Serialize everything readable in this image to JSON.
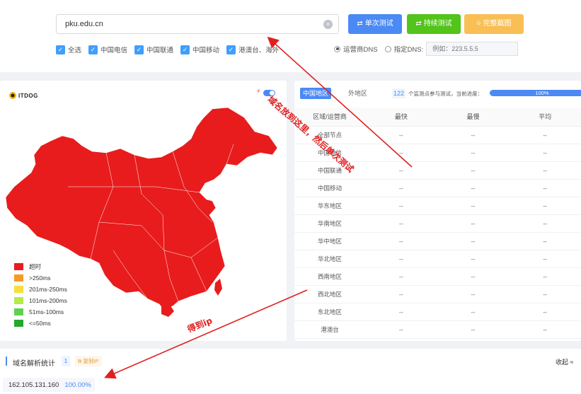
{
  "search": {
    "value": "pku.edu.cn",
    "clear": "×"
  },
  "buttons": {
    "single": "单次测试",
    "continuous": "持续测试",
    "screenshot": "完整截图",
    "single_icon": "⇄",
    "continuous_icon": "⇄",
    "screenshot_icon": "⌾"
  },
  "filters": [
    {
      "label": "全选",
      "checked": true
    },
    {
      "label": "中国电信",
      "checked": true
    },
    {
      "label": "中国联通",
      "checked": true
    },
    {
      "label": "中国移动",
      "checked": true
    },
    {
      "label": "港澳台、海外",
      "checked": true
    }
  ],
  "dns": {
    "carrier_label": "运营商DNS",
    "custom_label": "指定DNS:",
    "placeholder": "例如：223.5.5.5",
    "selected": "carrier"
  },
  "map": {
    "logo": "ITDOG",
    "map_color": "#e81c1c",
    "legend": [
      {
        "label": "超时",
        "color": "#e81c1c"
      },
      {
        "label": ">250ms",
        "color": "#f59a23"
      },
      {
        "label": "201ms-250ms",
        "color": "#f4e03a"
      },
      {
        "label": "101ms-200ms",
        "color": "#b6ea4a"
      },
      {
        "label": "51ms-100ms",
        "color": "#5fd14e"
      },
      {
        "label": "<=50ms",
        "color": "#22a92a"
      }
    ]
  },
  "results": {
    "tab_active": "中国地区",
    "tab_inactive": "外地区",
    "node_count": "122",
    "progress_label": "个监测点参与测试，当前进度：",
    "progress_percent": "100%",
    "progress_value": 1.0,
    "headers": [
      "区域/运营商",
      "最快",
      "最慢",
      "平均"
    ],
    "rows": [
      [
        "全部节点",
        "--",
        "--",
        "--"
      ],
      [
        "中国电信",
        "--",
        "--",
        "--"
      ],
      [
        "中国联通",
        "--",
        "--",
        "--"
      ],
      [
        "中国移动",
        "--",
        "--",
        "--"
      ],
      [
        "华东地区",
        "--",
        "--",
        "--"
      ],
      [
        "华南地区",
        "--",
        "--",
        "--"
      ],
      [
        "华中地区",
        "--",
        "--",
        "--"
      ],
      [
        "华北地区",
        "--",
        "--",
        "--"
      ],
      [
        "西南地区",
        "--",
        "--",
        "--"
      ],
      [
        "西北地区",
        "--",
        "--",
        "--"
      ],
      [
        "东北地区",
        "--",
        "--",
        "--"
      ],
      [
        "港澳台",
        "--",
        "--",
        "--"
      ]
    ]
  },
  "dns_stats": {
    "title": "域名解析统计",
    "count": "1",
    "copy_label": "复制IP",
    "collapse": "收起 ≈",
    "ip": "162.105.131.160",
    "percent": "100.00%"
  },
  "annotations": {
    "top": "域名放到这里，然后单次测试",
    "bottom": "得到ip",
    "color": "#e02020"
  }
}
